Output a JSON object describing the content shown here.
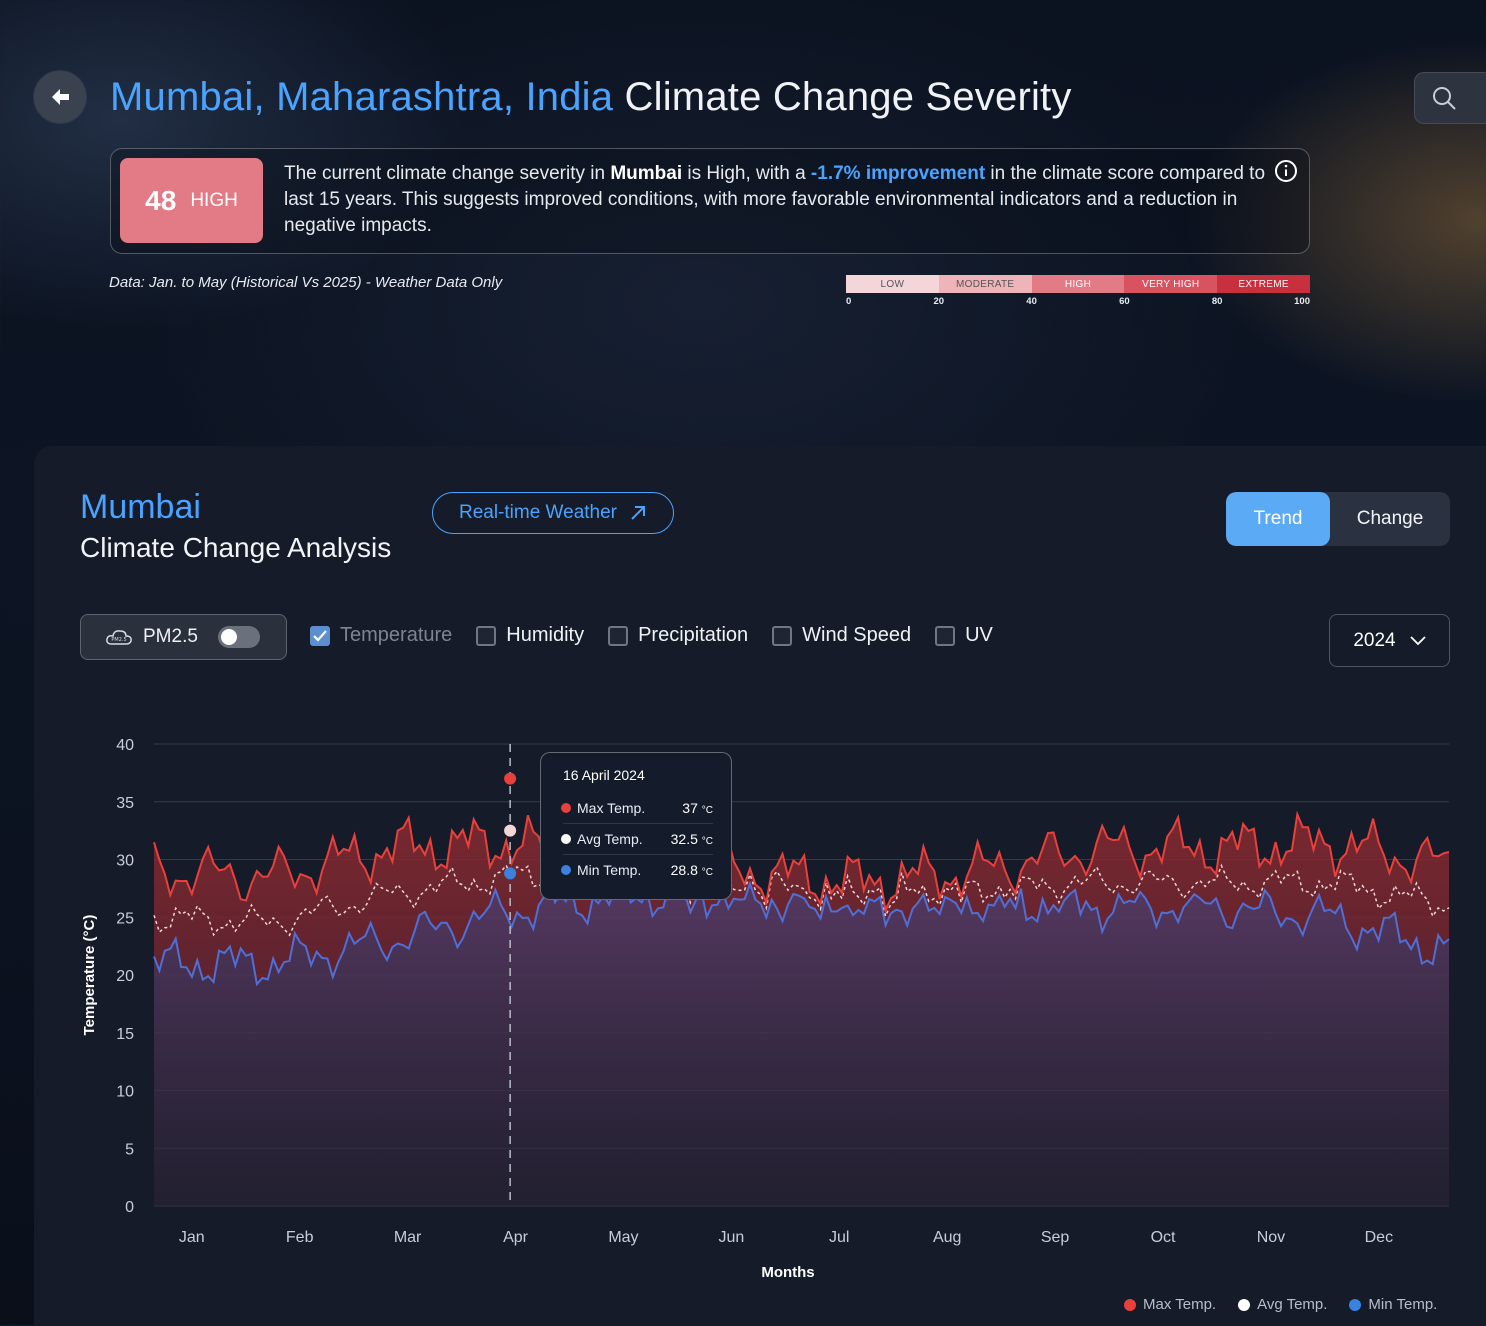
{
  "header": {
    "location": "Mumbai, Maharashtra, India",
    "title_rest": "Climate Change Severity",
    "back_icon": "arrow-left-icon",
    "search_icon": "search-icon"
  },
  "summary": {
    "score": "48",
    "level": "HIGH",
    "text_1": "The current climate change severity in ",
    "city": "Mumbai",
    "text_2": " is High, with a ",
    "improvement": "-1.7% improvement",
    "text_3": " in the climate score compared to last 15 years. This suggests improved conditions, with more favorable environmental indicators and a reduction in negative impacts.",
    "badge_color": "#e27b86"
  },
  "data_note": "Data: Jan. to May (Historical Vs 2025) - Weather Data Only",
  "scale": {
    "segments": [
      {
        "label": "LOW",
        "color": "#f4d6da",
        "text": "#555555"
      },
      {
        "label": "MODERATE",
        "color": "#eeb4ba",
        "text": "#555555"
      },
      {
        "label": "HIGH",
        "color": "#e27b86",
        "text": "#ffffff"
      },
      {
        "label": "VERY HIGH",
        "color": "#d8525f",
        "text": "#ffffff"
      },
      {
        "label": "EXTREME",
        "color": "#c9303d",
        "text": "#ffffff"
      }
    ],
    "ticks": [
      "0",
      "20",
      "40",
      "60",
      "80",
      "100"
    ]
  },
  "panel": {
    "city": "Mumbai",
    "subtitle": "Climate Change Analysis",
    "realtime_label": "Real-time Weather",
    "trend_label": "Trend",
    "change_label": "Change",
    "pm_label": "PM2.5",
    "checkboxes": [
      {
        "label": "Temperature",
        "checked": true
      },
      {
        "label": "Humidity",
        "checked": false
      },
      {
        "label": "Precipitation",
        "checked": false
      },
      {
        "label": "Wind Speed",
        "checked": false
      },
      {
        "label": "UV",
        "checked": false
      }
    ],
    "year": "2024"
  },
  "tooltip": {
    "date": "16 April 2024",
    "rows": [
      {
        "label": "Max Temp.",
        "value": "37",
        "unit": "°C",
        "color": "#e8413c"
      },
      {
        "label": "Avg Temp.",
        "value": "32.5",
        "unit": "°C",
        "color": "#ffffff"
      },
      {
        "label": "Min Temp.",
        "value": "28.8",
        "unit": "°C",
        "color": "#3b82e0"
      }
    ]
  },
  "chart_data": {
    "type": "area",
    "xlabel": "Months",
    "ylabel": "Temperature (°C)",
    "ylim": [
      0,
      40
    ],
    "yticks": [
      0,
      5,
      10,
      15,
      20,
      25,
      30,
      35,
      40
    ],
    "categories": [
      "Jan",
      "Feb",
      "Mar",
      "Apr",
      "May",
      "Jun",
      "Jul",
      "Aug",
      "Sep",
      "Oct",
      "Nov",
      "Dec"
    ],
    "legend_position": "bottom-right",
    "highlight": {
      "date": "16 April 2024",
      "max": 37,
      "avg": 32.5,
      "min": 28.8
    },
    "series": [
      {
        "name": "Max Temp.",
        "color": "#e8413c",
        "values": [
          29,
          28.5,
          31,
          31.5,
          29.5,
          29,
          28,
          29,
          31,
          31,
          31.5,
          29.5
        ]
      },
      {
        "name": "Avg Temp.",
        "color": "#ffffff",
        "values": [
          25,
          24.5,
          27,
          28.5,
          29,
          28.5,
          27.5,
          27.5,
          28,
          28,
          28,
          26
        ]
      },
      {
        "name": "Min Temp.",
        "color": "#3b82e0",
        "values": [
          21,
          21,
          23,
          25.5,
          27,
          27,
          26.5,
          26.5,
          26,
          26,
          25,
          22
        ]
      }
    ]
  },
  "legend": [
    {
      "label": "Max Temp.",
      "color": "#e8413c"
    },
    {
      "label": "Avg Temp.",
      "color": "#ffffff"
    },
    {
      "label": "Min Temp.",
      "color": "#3b82e0"
    }
  ]
}
